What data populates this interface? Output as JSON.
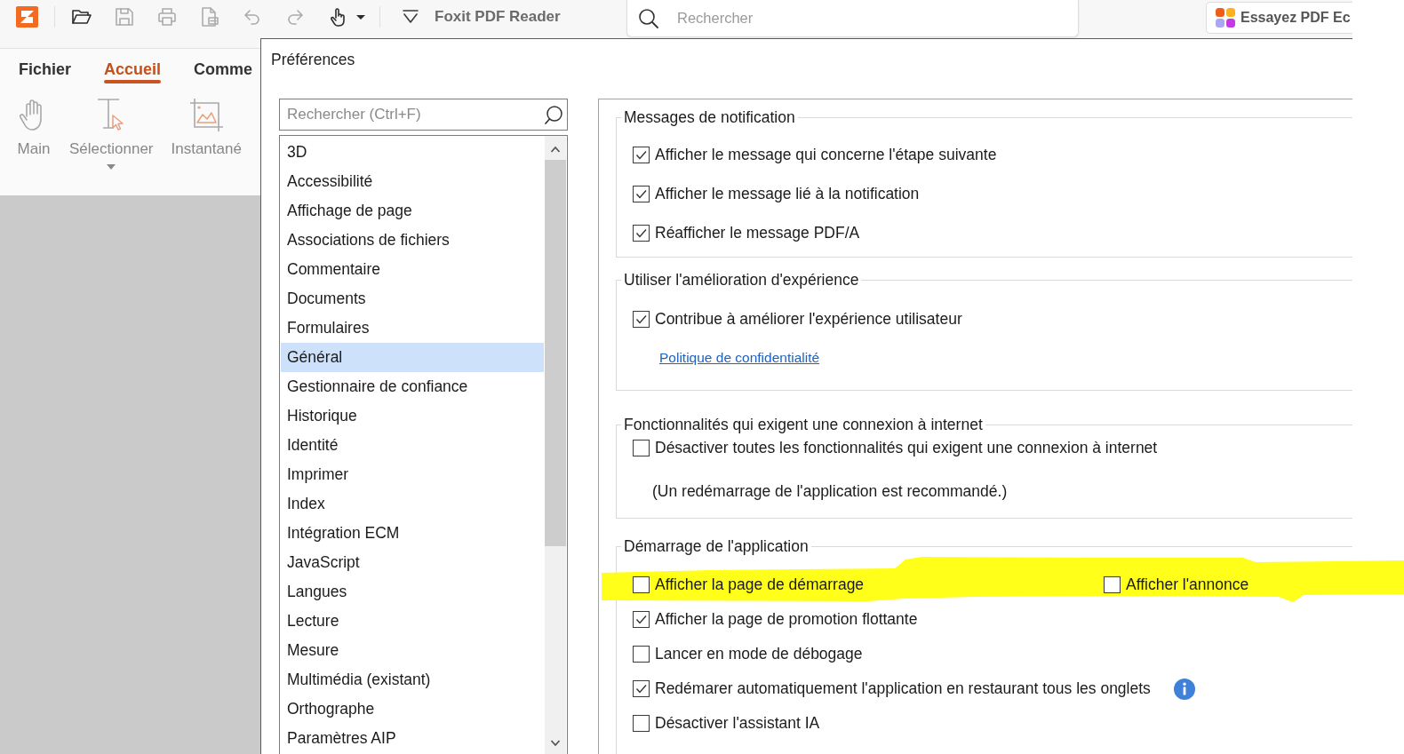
{
  "toolbar": {
    "buttons": [
      {
        "disabled": false
      },
      {
        "disabled": true
      },
      {
        "disabled": true
      },
      {
        "disabled": true
      },
      {
        "disabled": true
      },
      {
        "disabled": true
      },
      {
        "disabled": false
      },
      {
        "disabled": false
      }
    ],
    "app_title": "Foxit PDF Reader",
    "search": {
      "placeholder": "Rechercher"
    },
    "promo_button": "Essayez PDF Ec"
  },
  "ribbon": {
    "tabs": [
      {
        "label": "Fichier",
        "selected": false
      },
      {
        "label": "Accueil",
        "selected": true
      },
      {
        "label": "Comme",
        "selected": false
      }
    ],
    "tools": [
      {
        "label": "Main",
        "dropdown": false
      },
      {
        "label": "Sélectionner",
        "dropdown": true
      },
      {
        "label": "Instantané",
        "dropdown": false
      }
    ]
  },
  "dialog": {
    "title": "Préférences",
    "search": {
      "placeholder": "Rechercher (Ctrl+F)"
    },
    "categories": [
      {
        "label": "3D",
        "selected": false
      },
      {
        "label": "Accessibilité",
        "selected": false
      },
      {
        "label": "Affichage de page",
        "selected": false
      },
      {
        "label": "Associations de fichiers",
        "selected": false
      },
      {
        "label": "Commentaire",
        "selected": false
      },
      {
        "label": "Documents",
        "selected": false
      },
      {
        "label": "Formulaires",
        "selected": false
      },
      {
        "label": "Général",
        "selected": true
      },
      {
        "label": "Gestionnaire de confiance",
        "selected": false
      },
      {
        "label": "Historique",
        "selected": false
      },
      {
        "label": "Identité",
        "selected": false
      },
      {
        "label": "Imprimer",
        "selected": false
      },
      {
        "label": "Index",
        "selected": false
      },
      {
        "label": "Intégration ECM",
        "selected": false
      },
      {
        "label": "JavaScript",
        "selected": false
      },
      {
        "label": "Langues",
        "selected": false
      },
      {
        "label": "Lecture",
        "selected": false
      },
      {
        "label": "Mesure",
        "selected": false
      },
      {
        "label": "Multimédia (existant)",
        "selected": false
      },
      {
        "label": "Orthographe",
        "selected": false
      },
      {
        "label": "Paramètres AIP",
        "selected": false
      }
    ],
    "groups": [
      {
        "title": "Messages de notification",
        "items": [
          {
            "kind": "checkbox",
            "label": "Afficher le message qui concerne l'étape suivante",
            "checked": true
          },
          {
            "kind": "checkbox",
            "label": "Afficher le message lié à la notification",
            "checked": true
          },
          {
            "kind": "checkbox",
            "label": "Réafficher le message PDF/A",
            "checked": true
          }
        ]
      },
      {
        "title": "Utiliser l'amélioration d'expérience",
        "items": [
          {
            "kind": "checkbox",
            "label": "Contribue à améliorer l'expérience utilisateur",
            "checked": true
          },
          {
            "kind": "link",
            "label": "Politique de confidentialité"
          }
        ]
      },
      {
        "title": "Fonctionnalités qui exigent une connexion à internet",
        "items": [
          {
            "kind": "checkbox",
            "label": "Désactiver toutes les fonctionnalités qui exigent une connexion à internet",
            "checked": false
          },
          {
            "kind": "note",
            "label": "(Un redémarrage de l'application est recommandé.)"
          }
        ]
      },
      {
        "title": "Démarrage de l'application",
        "items": [
          {
            "kind": "pair",
            "highlighted": true,
            "options": [
              {
                "label": "Afficher la page de démarrage",
                "checked": false
              },
              {
                "label": "Afficher l'annonce",
                "checked": false
              }
            ]
          },
          {
            "kind": "checkbox",
            "label": "Afficher la page de promotion flottante",
            "checked": true
          },
          {
            "kind": "checkbox",
            "label": "Lancer en mode de débogage",
            "checked": false
          },
          {
            "kind": "checkbox",
            "label": "Redémarer automatiquement l'application en restaurant tous les onglets",
            "checked": true,
            "info": true
          },
          {
            "kind": "checkbox",
            "label": "Désactiver l'assistant IA",
            "checked": false
          }
        ]
      }
    ]
  }
}
